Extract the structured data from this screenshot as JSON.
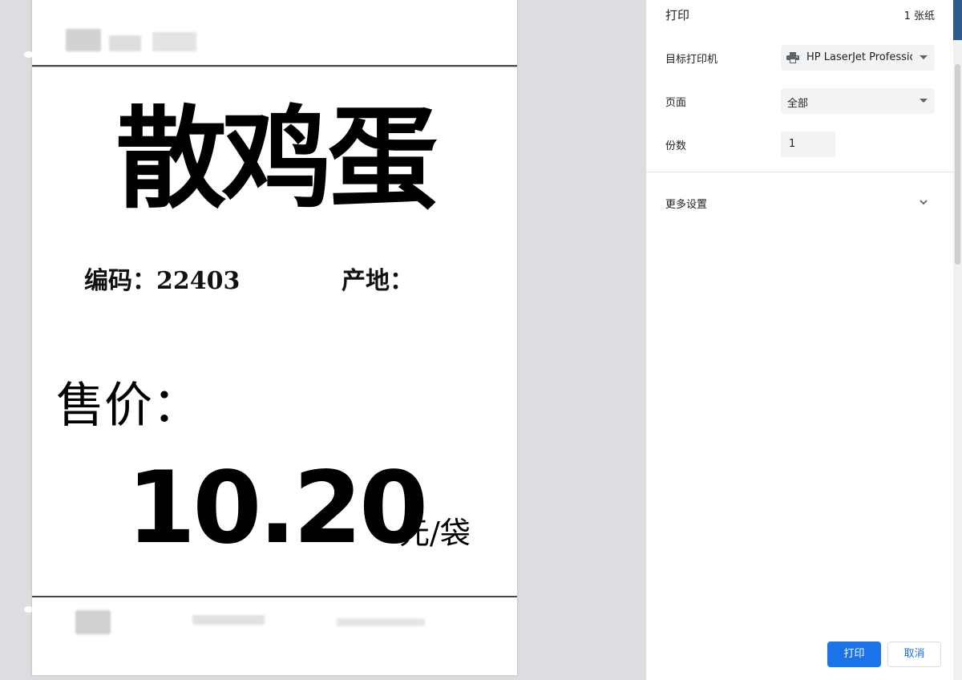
{
  "label": {
    "title": "散鸡蛋",
    "code_text": "编码：22403",
    "origin_text": "产地：",
    "sale_label": "售价：",
    "price": "10.20",
    "unit": "元/袋"
  },
  "panel": {
    "title": "打印",
    "sheets": "1 张纸",
    "destination_label": "目标打印机",
    "destination_value": "HP LaserJet Professic",
    "pages_label": "页面",
    "pages_value": "全部",
    "copies_label": "份数",
    "copies_value": "1",
    "more_settings": "更多设置",
    "print_button": "打印",
    "cancel_button": "取消"
  },
  "colors": {
    "primary": "#1a73e8",
    "panel_bg": "#ffffff",
    "preview_bg": "#dcdde1",
    "field_bg": "#f1f3f4"
  },
  "icons": {
    "printer": "printer-icon",
    "dropdown": "caret-down-icon",
    "expand": "chevron-down-icon"
  }
}
